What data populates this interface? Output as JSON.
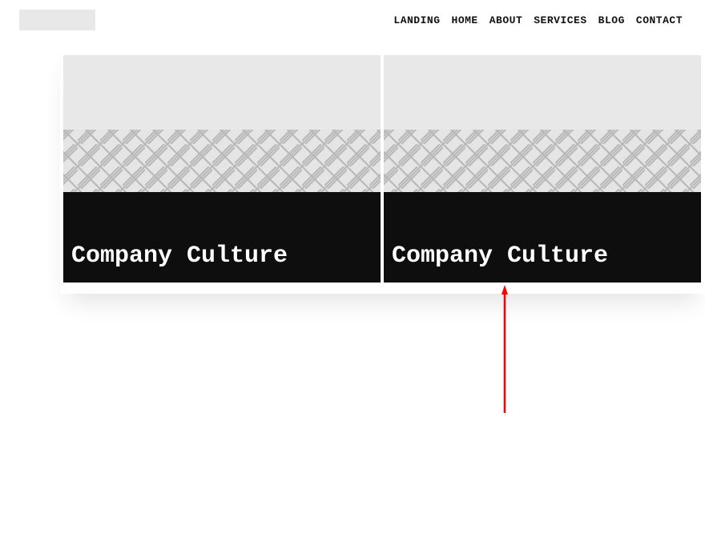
{
  "nav": {
    "items": [
      {
        "label": "LANDING"
      },
      {
        "label": "HOME"
      },
      {
        "label": "ABOUT"
      },
      {
        "label": "SERVICES"
      },
      {
        "label": "BLOG"
      },
      {
        "label": "CONTACT"
      }
    ]
  },
  "cards": [
    {
      "title": "Company Culture"
    },
    {
      "title": "Company Culture"
    }
  ],
  "annotation": {
    "color": "#ff0000"
  }
}
